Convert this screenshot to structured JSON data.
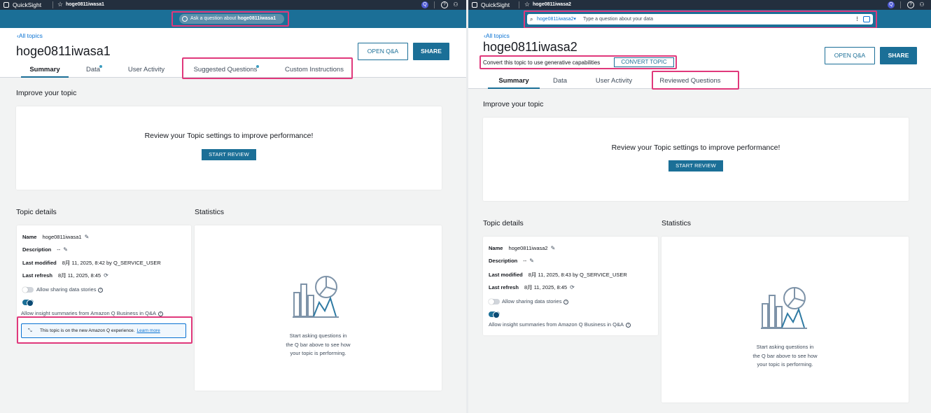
{
  "colors": {
    "topbar": "#232f3e",
    "qbar": "#1b6f97",
    "accent": "#1b6f97",
    "link": "#0972d3",
    "highlight": "#e0387b"
  },
  "left": {
    "app_name": "QuickSight",
    "topic_tab": "hoge0811iwasa1",
    "ask_prefix": "Ask a question about ",
    "ask_topic": "hoge0811iwasa1",
    "back": "All topics",
    "title": "hoge0811iwasa1",
    "open_qa": "OPEN Q&A",
    "share": "SHARE",
    "tabs": [
      "Summary",
      "Data",
      "User Activity",
      "Suggested Questions",
      "Custom Instructions"
    ],
    "improve_heading": "Improve your topic",
    "review_text": "Review your Topic settings to improve performance!",
    "review_button": "START REVIEW",
    "details_heading": "Topic details",
    "stats_heading": "Statistics",
    "details": {
      "name_label": "Name",
      "name_value": "hoge0811iwasa1",
      "desc_label": "Description",
      "desc_value": "--",
      "modified_label": "Last modified",
      "modified_value": "8月 11, 2025, 8:42 by Q_SERVICE_USER",
      "refresh_label": "Last refresh",
      "refresh_value": "8月 11, 2025, 8:45"
    },
    "toggle1_label": "Allow sharing data stories",
    "toggle2_label": "Allow insight summaries from Amazon Q Business in Q&A",
    "notice_text": "This topic is on the new Amazon Q experience.",
    "notice_link": "Learn more",
    "stats_text": [
      "Start asking questions in",
      "the Q bar above to see how",
      "your topic is performing."
    ]
  },
  "right": {
    "app_name": "QuickSight",
    "topic_tab": "hoge0811iwasa2",
    "search_topic": "hoge0811iwasa2",
    "search_placeholder": "Type a question about your data",
    "back": "All topics",
    "title": "hoge0811iwasa2",
    "convert_text": "Convert this topic to use generative capabilities",
    "convert_button": "CONVERT TOPIC",
    "open_qa": "OPEN Q&A",
    "share": "SHARE",
    "tabs": [
      "Summary",
      "Data",
      "User Activity",
      "Reviewed Questions"
    ],
    "improve_heading": "Improve your topic",
    "review_text": "Review your Topic settings to improve performance!",
    "review_button": "START REVIEW",
    "details_heading": "Topic details",
    "stats_heading": "Statistics",
    "details": {
      "name_label": "Name",
      "name_value": "hoge0811iwasa2",
      "desc_label": "Description",
      "desc_value": "--",
      "modified_label": "Last modified",
      "modified_value": "8月 11, 2025, 8:43 by Q_SERVICE_USER",
      "refresh_label": "Last refresh",
      "refresh_value": "8月 11, 2025, 8:45"
    },
    "toggle1_label": "Allow sharing data stories",
    "toggle2_label": "Allow insight summaries from Amazon Q Business in Q&A",
    "stats_text": [
      "Start asking questions in",
      "the Q bar above to see how",
      "your topic is performing."
    ]
  }
}
